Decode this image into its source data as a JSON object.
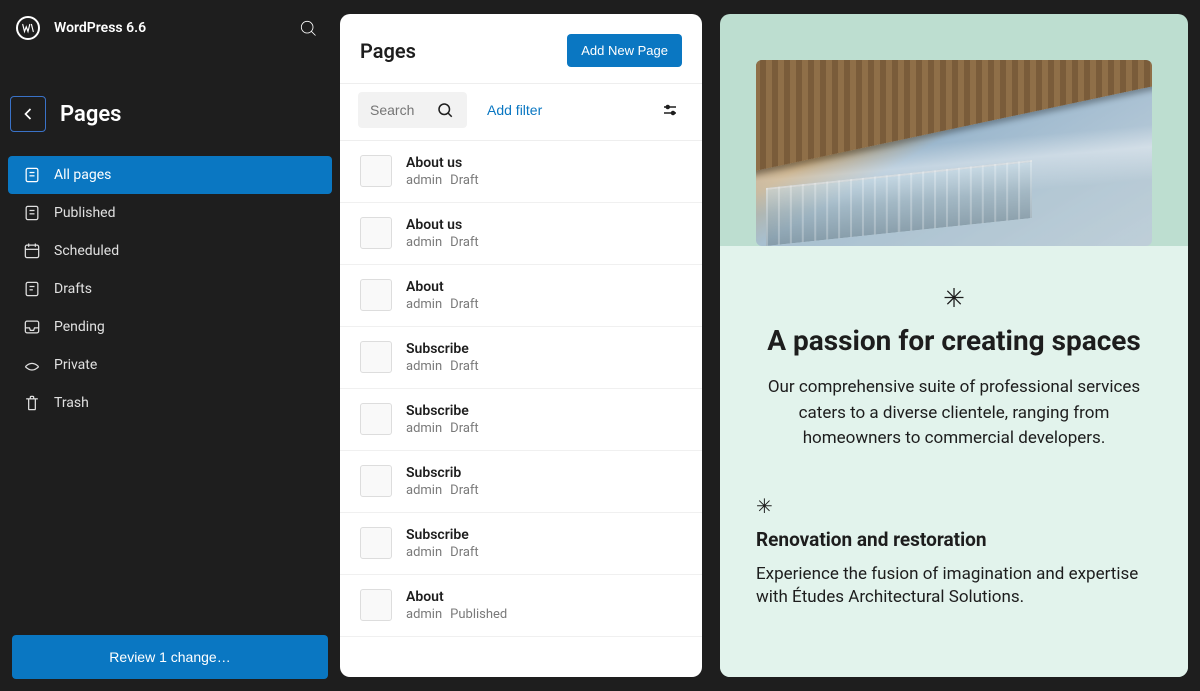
{
  "header": {
    "site_title": "WordPress 6.6"
  },
  "sidebar": {
    "section_title": "Pages",
    "items": [
      {
        "label": "All pages",
        "icon": "pages",
        "active": true
      },
      {
        "label": "Published",
        "icon": "pages",
        "active": false
      },
      {
        "label": "Scheduled",
        "icon": "calendar",
        "active": false
      },
      {
        "label": "Drafts",
        "icon": "draft",
        "active": false
      },
      {
        "label": "Pending",
        "icon": "inbox",
        "active": false
      },
      {
        "label": "Private",
        "icon": "private",
        "active": false
      },
      {
        "label": "Trash",
        "icon": "trash",
        "active": false
      }
    ],
    "review_label": "Review 1 change…"
  },
  "pages_panel": {
    "title": "Pages",
    "add_button": "Add New Page",
    "search_placeholder": "Search",
    "add_filter": "Add filter",
    "rows": [
      {
        "title": "About us",
        "author": "admin",
        "status": "Draft"
      },
      {
        "title": "About us",
        "author": "admin",
        "status": "Draft"
      },
      {
        "title": "About",
        "author": "admin",
        "status": "Draft"
      },
      {
        "title": "Subscribe",
        "author": "admin",
        "status": "Draft"
      },
      {
        "title": "Subscribe",
        "author": "admin",
        "status": "Draft"
      },
      {
        "title": "Subscrib",
        "author": "admin",
        "status": "Draft"
      },
      {
        "title": "Subscribe",
        "author": "admin",
        "status": "Draft"
      },
      {
        "title": "About",
        "author": "admin",
        "status": "Published"
      }
    ]
  },
  "preview": {
    "headline": "A passion for creating spaces",
    "lead": "Our comprehensive suite of professional services caters to a diverse clientele, ranging from homeowners to commercial developers.",
    "section_title": "Renovation and restoration",
    "section_body": "Experience the fusion of imagination and expertise with Études Architectural Solutions."
  }
}
